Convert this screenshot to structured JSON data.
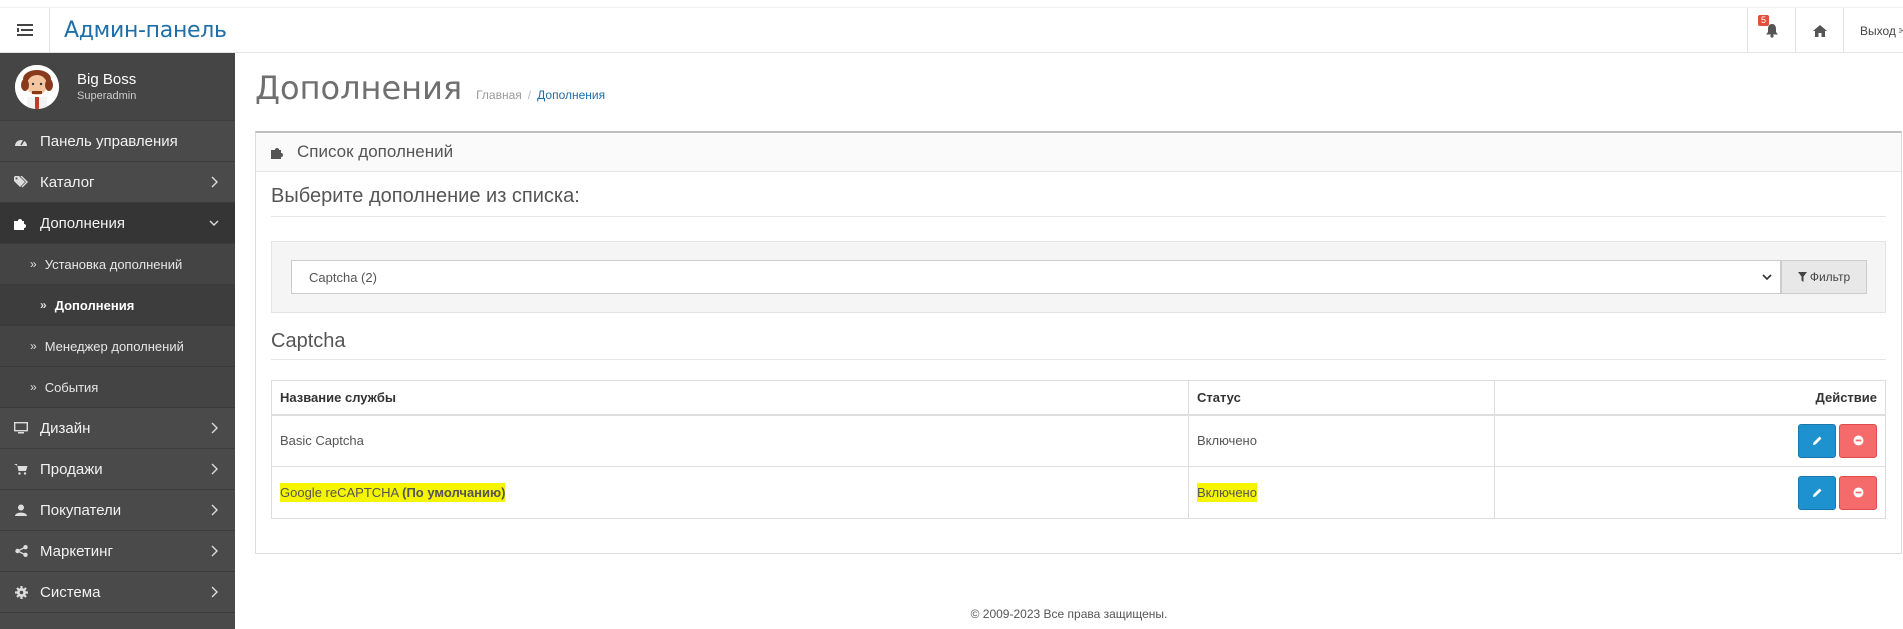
{
  "header": {
    "brand": "Админ-панель",
    "notification_count": "5",
    "logout_label": "Выход"
  },
  "profile": {
    "name": "Big Boss",
    "role": "Superadmin"
  },
  "sidebar": {
    "items": [
      {
        "label": "Панель управления"
      },
      {
        "label": "Каталог"
      },
      {
        "label": "Дополнения"
      },
      {
        "label": "Дизайн"
      },
      {
        "label": "Продажи"
      },
      {
        "label": "Покупатели"
      },
      {
        "label": "Маркетинг"
      },
      {
        "label": "Система"
      }
    ],
    "subitems": [
      {
        "label": "Установка дополнений"
      },
      {
        "label": "Дополнения"
      },
      {
        "label": "Менеджер дополнений"
      },
      {
        "label": "События"
      }
    ]
  },
  "page": {
    "title": "Дополнения",
    "breadcrumb": [
      "Главная",
      "Дополнения"
    ]
  },
  "panel": {
    "heading": "Список дополнений",
    "choose_label": "Выберите дополнение из списка:",
    "select_value": "Captcha (2)",
    "filter_label": "Фильтр",
    "section_title": "Captcha"
  },
  "table": {
    "headers": [
      "Название службы",
      "Статус",
      "Действие"
    ],
    "rows": [
      {
        "name": "Basic Captcha",
        "suffix": "",
        "status": "Включено"
      },
      {
        "name": "Google reCAPTCHA",
        "suffix": "(По умолчанию)",
        "status": "Включено"
      }
    ]
  },
  "footer": {
    "text": "© 2009-2023 Все права защищены."
  },
  "colors": {
    "sidebar_bg": "#4a4a4a",
    "brand": "#1e6ea8",
    "edit_button": "#1e91cf",
    "delete_button": "#f56b6b",
    "highlight": "#f5f500"
  }
}
